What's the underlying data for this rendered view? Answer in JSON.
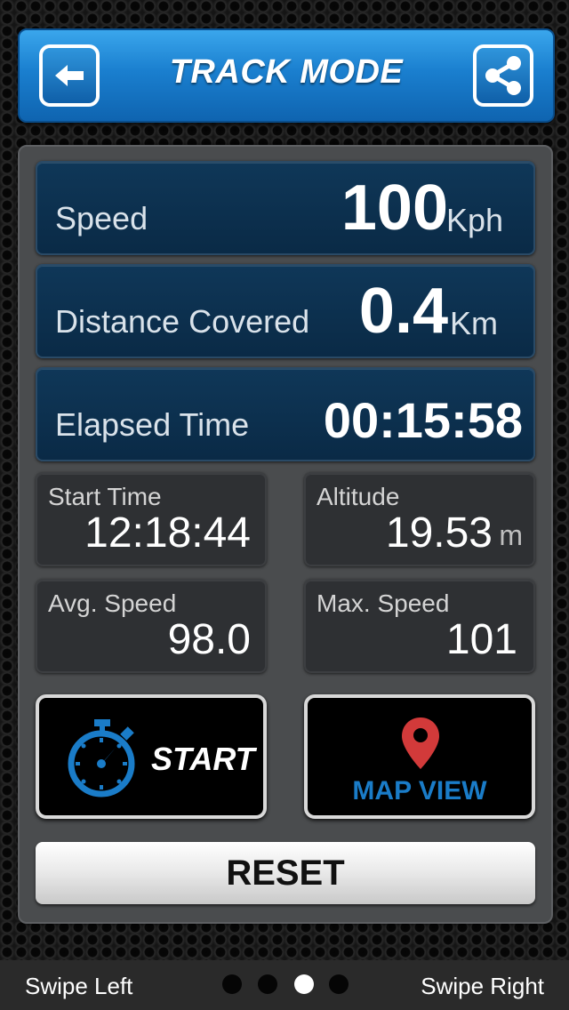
{
  "header": {
    "title": "TRACK MODE",
    "back_icon": "back-arrow-icon",
    "share_icon": "share-icon"
  },
  "speed": {
    "label": "Speed",
    "value": "100",
    "unit": "Kph"
  },
  "distance": {
    "label": "Distance Covered",
    "value": "0.4",
    "unit": "Km"
  },
  "elapsed": {
    "label": "Elapsed Time",
    "value": "00:15:58"
  },
  "start_time": {
    "label": "Start Time",
    "value": "12:18:44"
  },
  "altitude": {
    "label": "Altitude",
    "value": "19.53",
    "unit": "m"
  },
  "avg_speed": {
    "label": "Avg. Speed",
    "value": "98.0"
  },
  "max_speed": {
    "label": "Max. Speed",
    "value": "101"
  },
  "start_button": {
    "label": "START",
    "icon": "stopwatch-icon"
  },
  "map_button": {
    "label": "MAP VIEW",
    "icon": "map-pin-icon"
  },
  "reset_button": {
    "label": "RESET"
  },
  "footer": {
    "left": "Swipe Left",
    "right": "Swipe Right",
    "page_count": 4,
    "active_page": 3
  },
  "colors": {
    "header_blue": "#1a7fcf",
    "accent_blue": "#1a7cc8",
    "pin_red": "#d23a3a"
  }
}
